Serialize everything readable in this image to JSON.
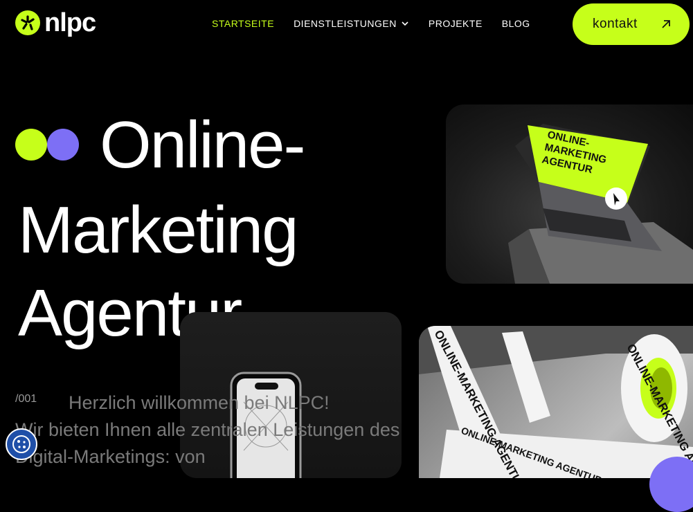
{
  "brand": {
    "logo_text": "nlpc",
    "logo_icon": "sparkle-icon",
    "accent": "#c6ff1a",
    "purple": "#7d6ff5"
  },
  "nav": {
    "items": [
      {
        "label": "STARTSEITE",
        "active": true
      },
      {
        "label": "DIENSTLEISTUNGEN",
        "has_dropdown": true
      },
      {
        "label": "PROJEKTE"
      },
      {
        "label": "BLOG"
      }
    ],
    "cta": {
      "label": "kontakt",
      "icon": "arrow-up-right-icon"
    }
  },
  "hero": {
    "title_lines": [
      "Online-",
      "Marketing",
      "Agentur"
    ],
    "laptop_screen_text": [
      "ONLINE-",
      "MARKETING",
      "AGENTUR"
    ],
    "tape_text": "ONLINE-MARKETING AGENTUR"
  },
  "intro": {
    "section_number": "/001",
    "line1": "Herzlich willkommen bei NLPC!",
    "rest": "Wir bieten Ihnen alle zentralen Leistungen des Digital-Marketings: von"
  },
  "cookie_widget": {
    "icon": "cookie-icon"
  }
}
